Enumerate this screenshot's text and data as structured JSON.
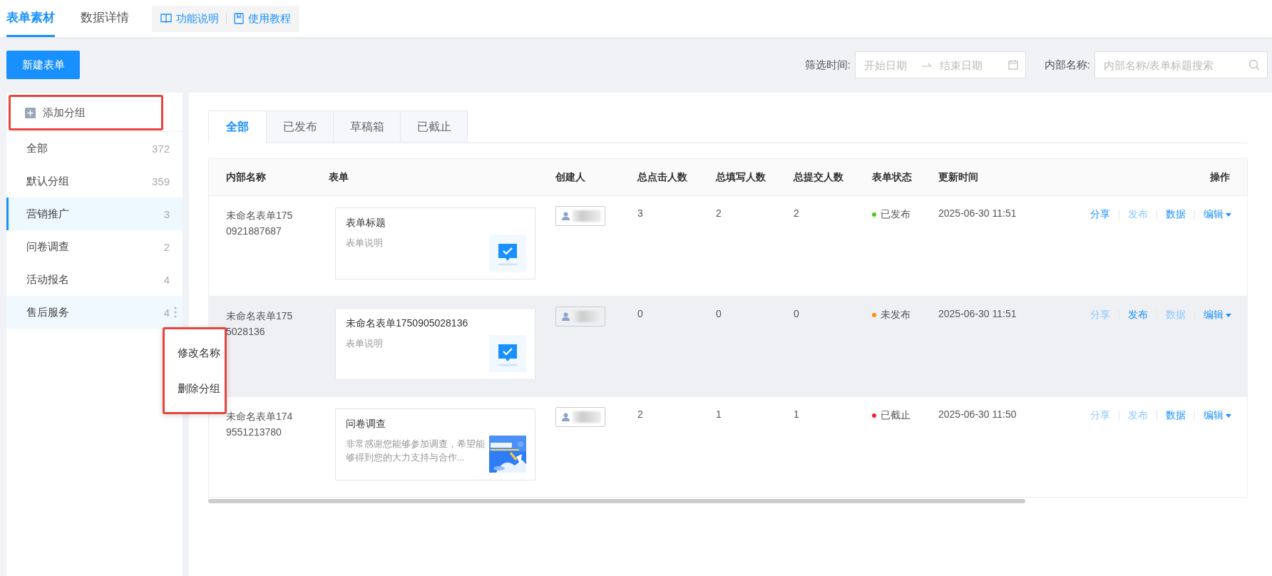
{
  "top_tabs": [
    {
      "label": "表单素材",
      "selected": true
    },
    {
      "label": "数据详情",
      "selected": false
    }
  ],
  "help_links": [
    {
      "label": "功能说明",
      "kind": "book"
    },
    {
      "label": "使用教程",
      "kind": "doc"
    }
  ],
  "new_button": "新建表单",
  "filters": {
    "time_label": "筛选时间:",
    "start_placeholder": "开始日期",
    "end_placeholder": "结束日期",
    "name_label": "内部名称:",
    "search_placeholder": "内部名称/表单标题搜索"
  },
  "sidebar": {
    "add_group": "添加分组",
    "items": [
      {
        "label": "全部",
        "count": "372",
        "selected": false,
        "menu_open": false
      },
      {
        "label": "默认分组",
        "count": "359",
        "selected": false,
        "menu_open": false
      },
      {
        "label": "营销推广",
        "count": "3",
        "selected": true,
        "menu_open": false
      },
      {
        "label": "问卷调查",
        "count": "2",
        "selected": false,
        "menu_open": false
      },
      {
        "label": "活动报名",
        "count": "4",
        "selected": false,
        "menu_open": false
      },
      {
        "label": "售后服务",
        "count": "4",
        "selected": false,
        "menu_open": true
      }
    ],
    "context_menu": [
      "修改名称",
      "删除分组"
    ]
  },
  "status_tabs": [
    {
      "label": "全部",
      "selected": true
    },
    {
      "label": "已发布",
      "selected": false
    },
    {
      "label": "草稿箱",
      "selected": false
    },
    {
      "label": "已截止",
      "selected": false
    }
  ],
  "table": {
    "columns": [
      "内部名称",
      "表单",
      "创建人",
      "总点击人数",
      "总填写人数",
      "总提交人数",
      "表单状态",
      "更新时间",
      "操作"
    ],
    "rows": [
      {
        "internal_name": [
          "未命名表单175",
          "0921887687"
        ],
        "form": {
          "title": "表单标题",
          "description": "表单说明",
          "kind": "icon"
        },
        "clicks": "3",
        "fills": "2",
        "submits": "2",
        "status": {
          "label": "已发布",
          "color": "#52c41a"
        },
        "updated": "2025-06-30 11:51",
        "hovered": false,
        "actions": [
          {
            "label": "分享",
            "kind": "link",
            "disabled": false
          },
          {
            "label": "发布",
            "kind": "link",
            "disabled": true
          },
          {
            "label": "数据",
            "kind": "link",
            "disabled": false
          },
          {
            "label": "编辑",
            "kind": "dropdown",
            "disabled": false
          }
        ]
      },
      {
        "internal_name": [
          "未命名表单175",
          "5028136"
        ],
        "form": {
          "title": "未命名表单1750905028136",
          "description": "表单说明",
          "kind": "icon"
        },
        "clicks": "0",
        "fills": "0",
        "submits": "0",
        "status": {
          "label": "未发布",
          "color": "#fa8c16"
        },
        "updated": "2025-06-30 11:51",
        "hovered": true,
        "actions": [
          {
            "label": "分享",
            "kind": "link",
            "disabled": true
          },
          {
            "label": "发布",
            "kind": "link",
            "disabled": false
          },
          {
            "label": "数据",
            "kind": "link",
            "disabled": true
          },
          {
            "label": "编辑",
            "kind": "dropdown",
            "disabled": false
          }
        ]
      },
      {
        "internal_name": [
          "未命名表单174",
          "9551213780"
        ],
        "form": {
          "title": "问卷调查",
          "description": "非常感谢您能够参加调查，希望能够得到您的大力支持与合作...",
          "kind": "picture"
        },
        "clicks": "2",
        "fills": "1",
        "submits": "1",
        "status": {
          "label": "已截止",
          "color": "#f5222d"
        },
        "updated": "2025-06-30 11:50",
        "hovered": false,
        "actions": [
          {
            "label": "分享",
            "kind": "link",
            "disabled": true
          },
          {
            "label": "发布",
            "kind": "link",
            "disabled": true
          },
          {
            "label": "数据",
            "kind": "link",
            "disabled": false
          },
          {
            "label": "编辑",
            "kind": "dropdown",
            "disabled": false
          }
        ]
      }
    ]
  }
}
